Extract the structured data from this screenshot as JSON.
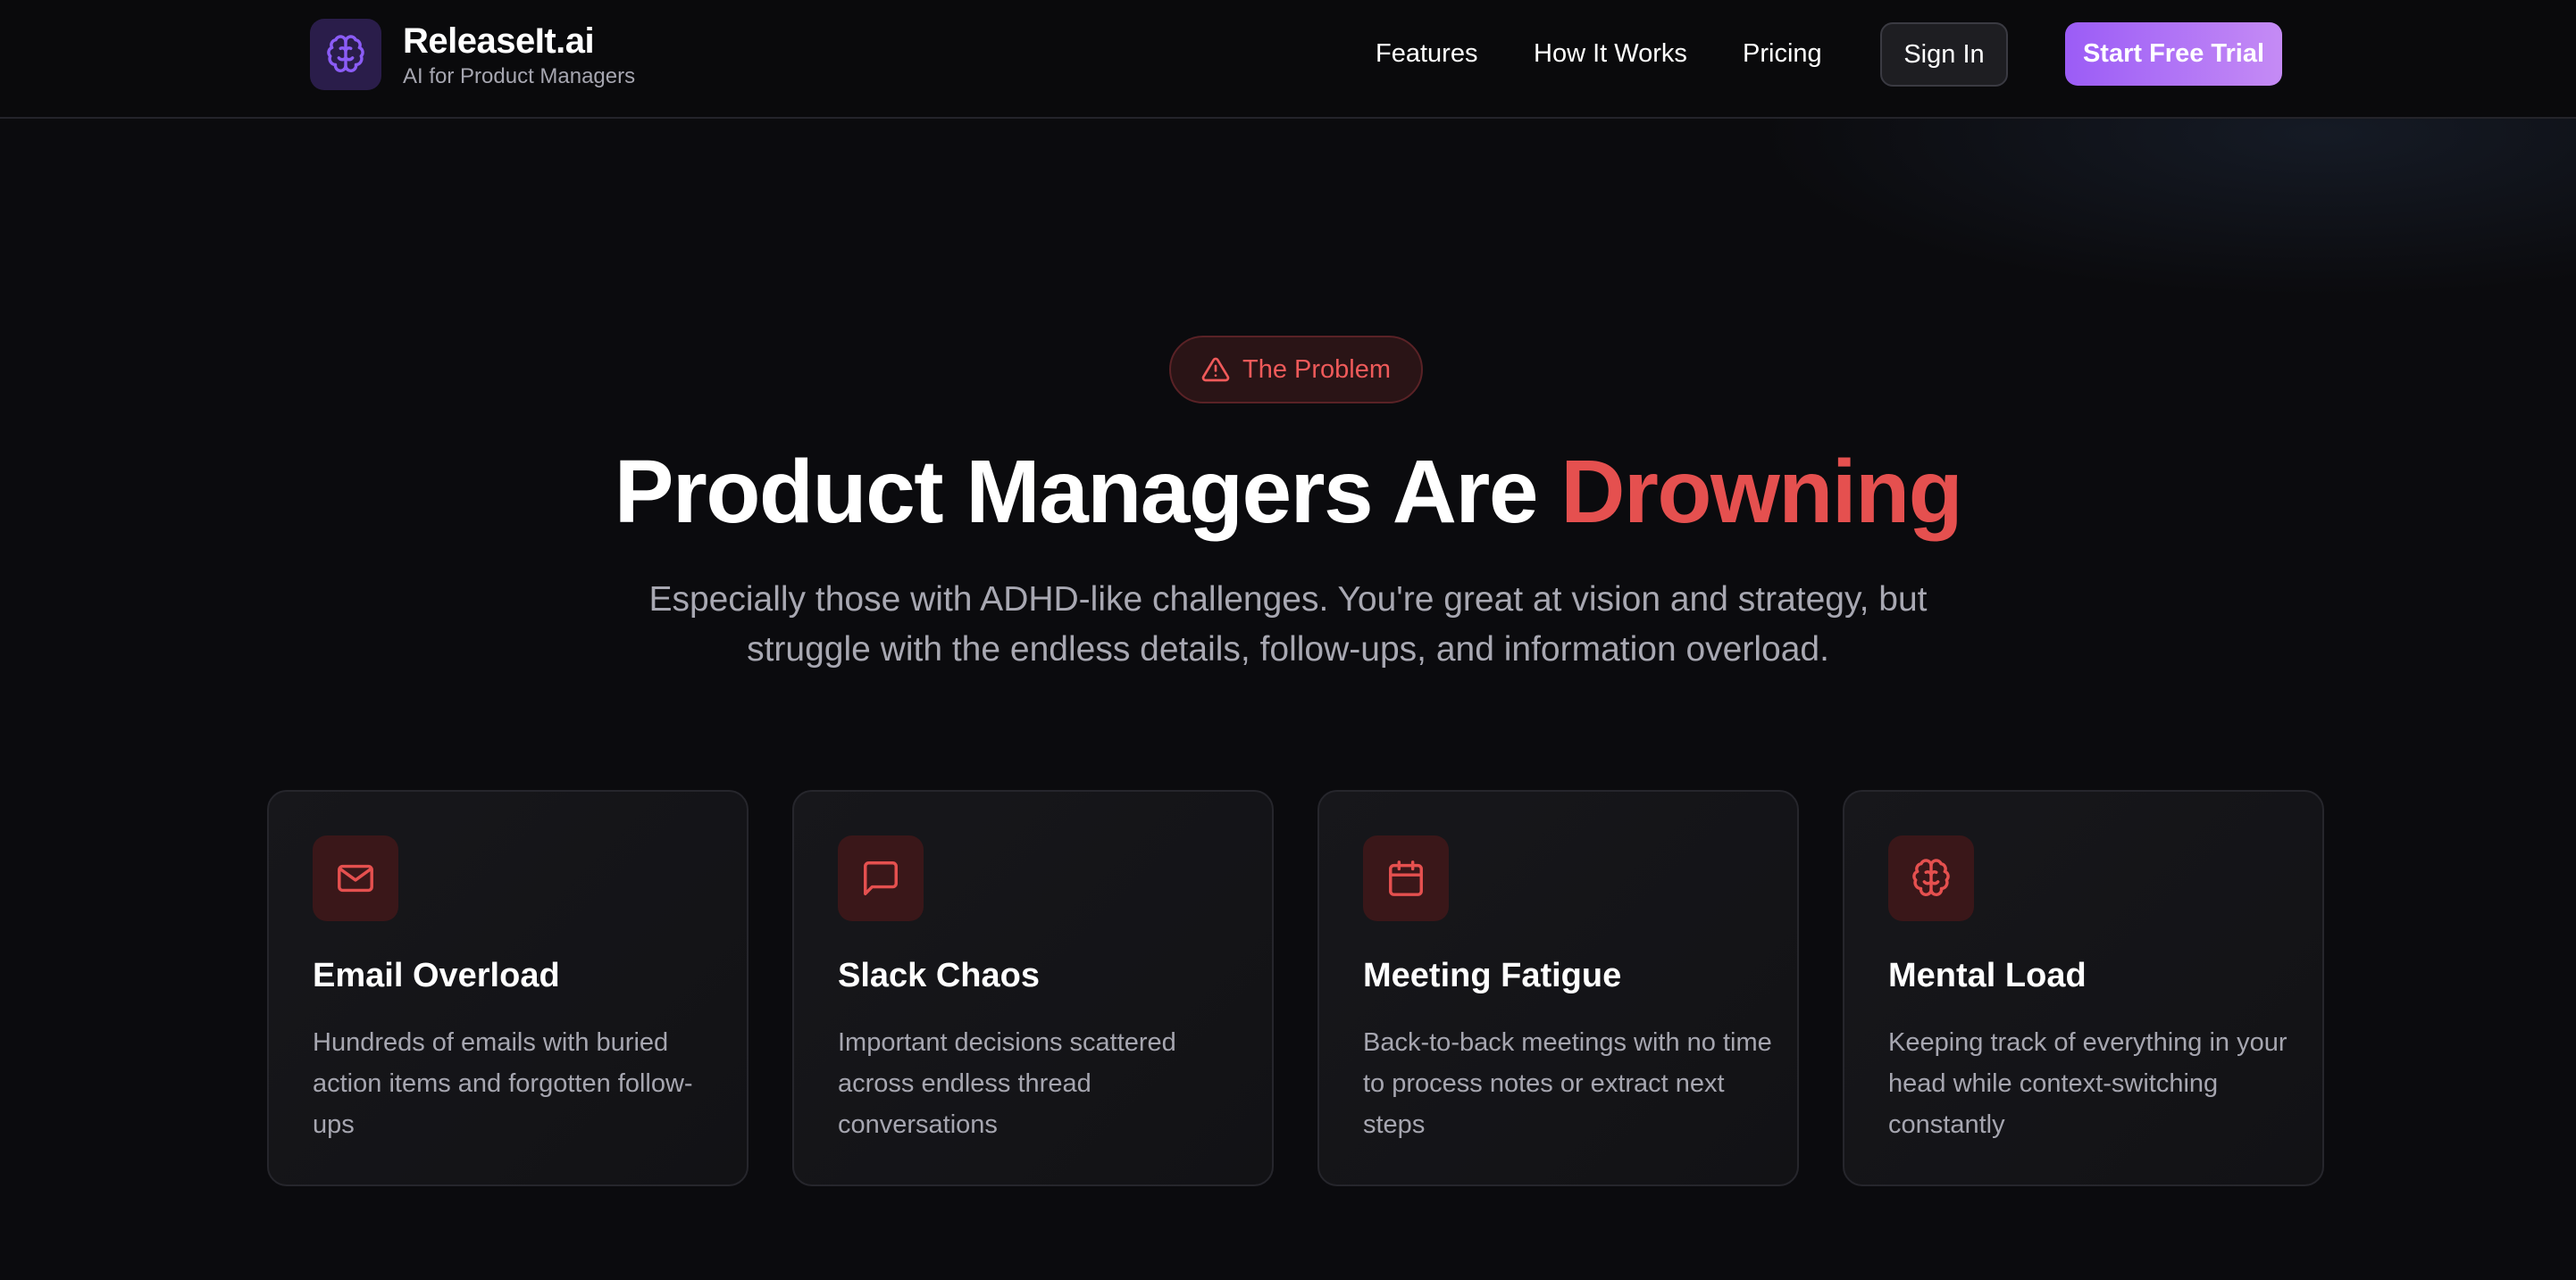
{
  "brand": {
    "name": "ReleaseIt.ai",
    "tagline": "AI for Product Managers",
    "icon": "brain-icon",
    "accent_color": "#8b5cf6"
  },
  "nav": {
    "links": [
      {
        "label": "Features"
      },
      {
        "label": "How It Works"
      },
      {
        "label": "Pricing"
      }
    ],
    "sign_in_label": "Sign In",
    "trial_label": "Start Free Trial"
  },
  "hero": {
    "badge_icon": "alert-triangle-icon",
    "badge_label": "The Problem",
    "headline_main": "Product Managers Are ",
    "headline_accent": "Drowning",
    "accent_color": "#e5504f",
    "subtext": "Especially those with ADHD-like challenges. You're great at vision and strategy, but struggle with the endless details, follow-ups, and information overload."
  },
  "cards": [
    {
      "icon": "mail-icon",
      "title": "Email Overload",
      "description": "Hundreds of emails with buried action items and forgotten follow-ups"
    },
    {
      "icon": "message-square-icon",
      "title": "Slack Chaos",
      "description": "Important decisions scattered across endless thread conversations"
    },
    {
      "icon": "calendar-icon",
      "title": "Meeting Fatigue",
      "description": "Back-to-back meetings with no time to process notes or extract next steps"
    },
    {
      "icon": "brain-icon",
      "title": "Mental Load",
      "description": "Keeping track of everything in your head while context-switching constantly"
    }
  ]
}
